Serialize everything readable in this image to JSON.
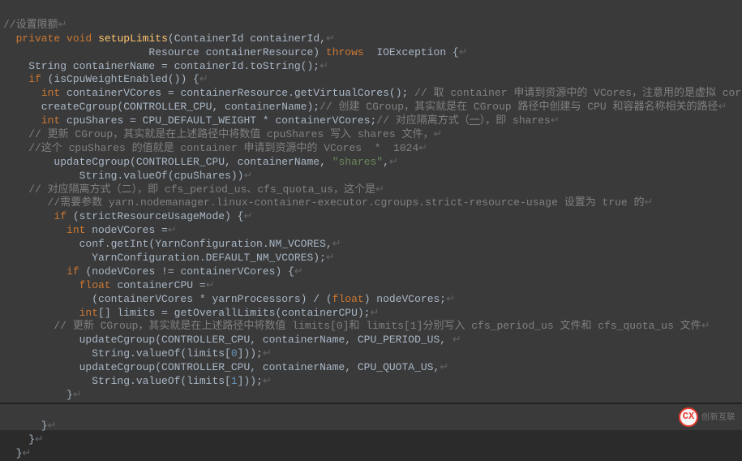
{
  "code": {
    "l1": "//设置限额",
    "l2a": "  private",
    "l2b": "void",
    "l2c": "setupLimits",
    "l2d": "(ContainerId containerId,",
    "l3": "                       Resource containerResource)",
    "l3a": "throws",
    "l3b": "IOException {",
    "l4": "    String containerName = containerId.toString();",
    "l5a": "    if",
    "l5b": "(isCpuWeightEnabled()) {",
    "l6a": "      int",
    "l6b": "containerVCores = containerResource.getVirtualCores();",
    "l6c": "// 取 container 申请到资源中的 VCores，注意用的是虚拟 core",
    "l7a": "      createCgroup(CONTROLLER_CPU, containerName);",
    "l7b": "// 创建 CGroup，其实就是在 CGroup 路径中创建与 CPU 和容器名称相关的路径",
    "l8a": "      int",
    "l8b": "cpuShares = CPU_DEFAULT_WEIGHT * containerVCores;",
    "l8c": "// 对应隔离方式（",
    "l8d": "一",
    "l8e": "），即 shares",
    "l9": "    // 更新 CGroup，其实就是在上述路径中将数值 cpuShares 写入 shares 文件，",
    "l10": "    //这个 cpuShares 的值就是 container 申请到资源中的 VCores  *  1024",
    "l11a": "        updateCgroup(CONTROLLER_CPU, containerName,",
    "l11b": "\"shares\"",
    "l11c": ",",
    "l12": "            String.valueOf(cpuShares))",
    "l13": "    // 对应隔离方式（二），即 cfs_period_us、cfs_quota_us，这个是",
    "l14": "       //需要参数 yarn.nodemanager.linux-container-executor.cgroups.strict-resource-usage 设置为 true 的",
    "l15a": "        if",
    "l15b": "(strictResourceUsageMode) {",
    "l16a": "          int",
    "l16b": "nodeVCores =",
    "l17": "            conf.getInt(YarnConfiguration.NM_VCORES,",
    "l18": "              YarnConfiguration.DEFAULT_NM_VCORES);",
    "l19a": "          if",
    "l19b": "(nodeVCores != containerVCores) {",
    "l20a": "            float",
    "l20b": "containerCPU =",
    "l21a": "              (containerVCores * yarnProcessors) / (",
    "l21b": "float",
    "l21c": ") nodeVCores;",
    "l22a": "            int",
    "l22b": "[] limits = getOverallLimits(containerCPU);",
    "l23": "        // 更新 CGroup，其实就是在上述路径中将数值 limits[0]和 limits[1]分别写入 cfs_period_us 文件和 cfs_quota_us 文件",
    "l24": "            updateCgroup(CONTROLLER_CPU, containerName, CPU_PERIOD_US, ",
    "l25a": "              String.valueOf(limits[",
    "l25b": "0",
    "l25c": "]));",
    "l26": "            updateCgroup(CONTROLLER_CPU, containerName, CPU_QUOTA_US,",
    "l27a": "              String.valueOf(limits[",
    "l27b": "1",
    "l27c": "]));",
    "l28": "          }",
    "l29": "        }",
    "b1": "      }",
    "b2": "    }",
    "b3": "  }"
  },
  "logo": {
    "mark": "CX",
    "text": "创新互联"
  },
  "eol": "↵"
}
